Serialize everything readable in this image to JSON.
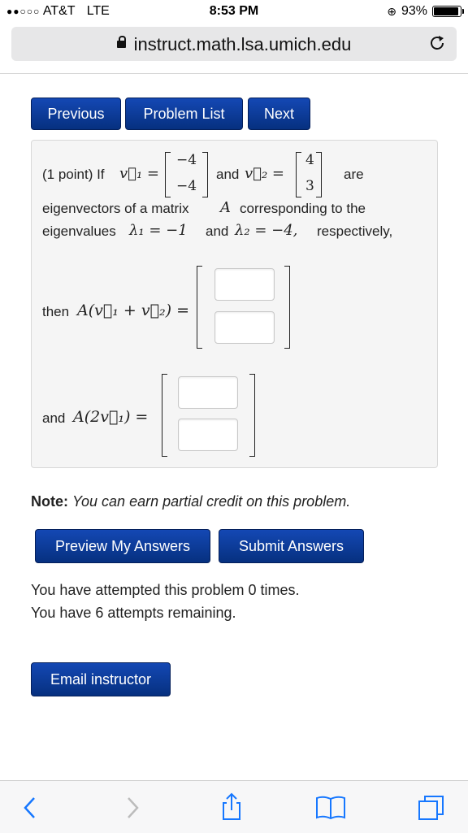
{
  "status": {
    "carrier": "AT&T",
    "network": "LTE",
    "time": "8:53 PM",
    "battery": "93%",
    "battery_level": 0.93
  },
  "browser": {
    "url": "instruct.math.lsa.umich.edu"
  },
  "nav": {
    "previous": "Previous",
    "problem_list": "Problem List",
    "next": "Next"
  },
  "problem": {
    "intro": "(1 point) If",
    "v1_label": "v⃗₁ =",
    "v1": [
      "−4",
      "−4"
    ],
    "and": "and",
    "v2_label": "v⃗₂ =",
    "v2": [
      "4",
      "3"
    ],
    "are": "are",
    "line2_a": "eigenvectors of a matrix",
    "matrix_A": "A",
    "line2_b": "corresponding to the",
    "line3_a": "eigenvalues",
    "lambda1": "λ₁ = −1",
    "line3_and": "and",
    "lambda2": "λ₂ = −4,",
    "line3_b": "respectively,",
    "then_label": "then",
    "expr1": "A(v⃗₁ + v⃗₂) =",
    "and_label": "and",
    "expr2": "A(2v⃗₁) ="
  },
  "note": {
    "bold": "Note:",
    "text": "You can earn partial credit on this problem."
  },
  "actions": {
    "preview": "Preview My Answers",
    "submit": "Submit Answers"
  },
  "attempts": {
    "line1": "You have attempted this problem 0 times.",
    "line2": "You have 6 attempts remaining."
  },
  "email": {
    "label": "Email instructor"
  },
  "icons": {
    "back": "chevron-left-icon",
    "forward": "chevron-right-icon",
    "share": "share-icon",
    "bookmarks": "book-icon",
    "tabs": "tabs-icon"
  }
}
